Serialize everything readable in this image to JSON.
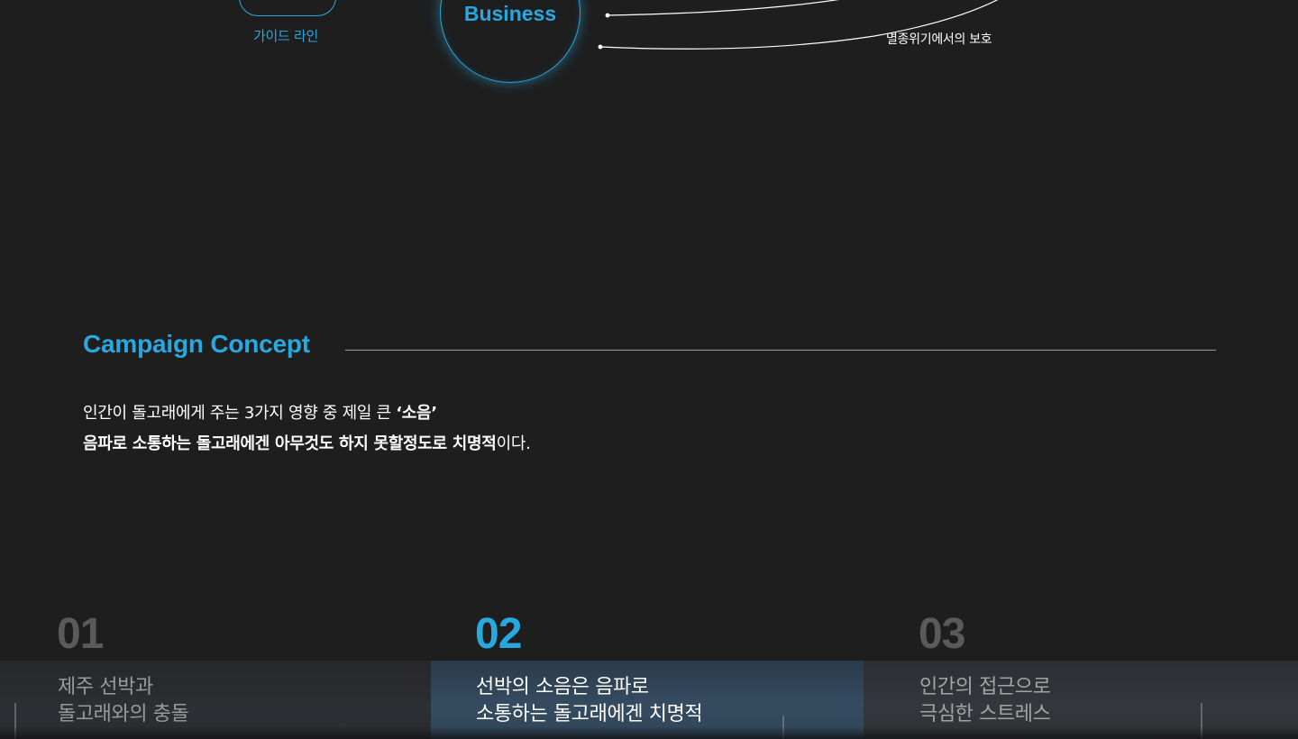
{
  "diagram": {
    "guide_label": "가이드 라인",
    "business_label": "Business",
    "protect_label": "멸종위기에서의 보호",
    "accent_color": "#29a8e0"
  },
  "concept": {
    "title": "Campaign Concept",
    "line1_prefix": "인간이 돌고래에게 주는 3가지 영향 중 제일 큰 ",
    "line1_bold": "‘소음’",
    "line2_bold": "음파로 소통하는 돌고래에겐 아무것도 하지 못할정도로 치명적",
    "line2_suffix": "이다."
  },
  "panels": [
    {
      "number": "01",
      "caption_line1": "제주 선박과",
      "caption_line2": "돌고래와의 충돌"
    },
    {
      "number": "02",
      "caption_line1": "선박의 소음은 음파로",
      "caption_line2": "소통하는 돌고래에겐 치명적"
    },
    {
      "number": "03",
      "caption_line1": "인간의 접근으로",
      "caption_line2": "극심한 스트레스"
    }
  ]
}
